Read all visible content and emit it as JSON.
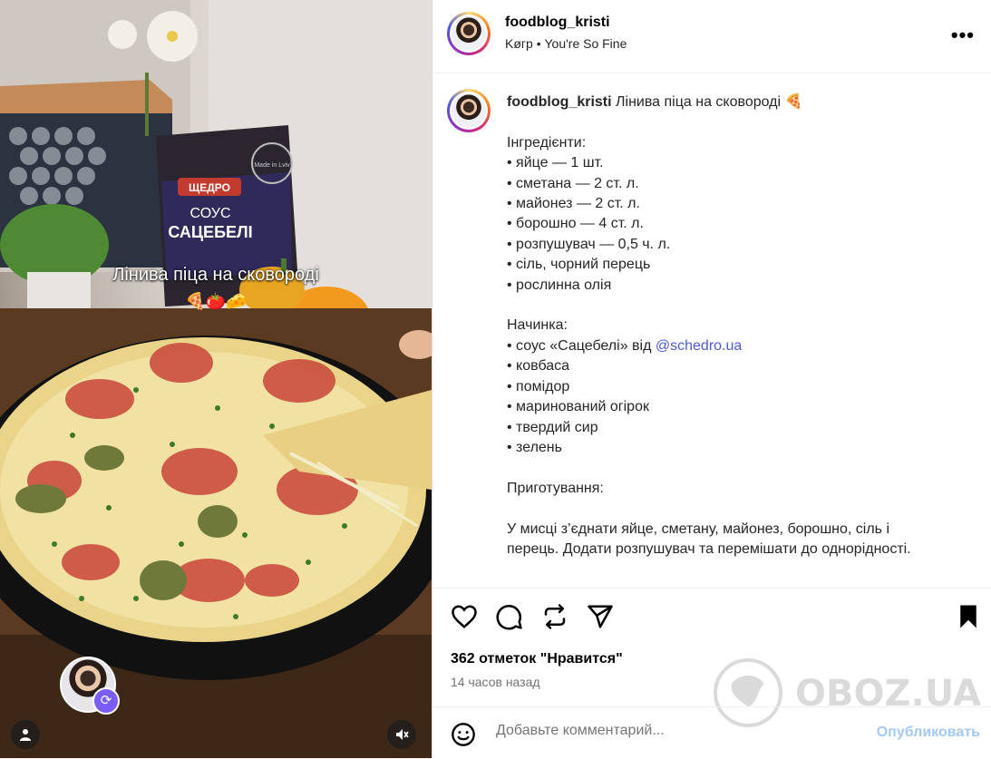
{
  "media": {
    "overlay_caption": "Лінива піца на сковороді",
    "overlay_emoji": "🍕🍅🧀",
    "package_brand": "ЩЕДРО",
    "package_type": "СОУС",
    "package_name": "САЦЕБЕЛІ",
    "package_stamp": "Made in Lviv"
  },
  "header": {
    "username": "foodblog_kristi",
    "audio_artist": "Køгр",
    "audio_separator": "•",
    "audio_track": "You're So Fine",
    "more_icon": "•••"
  },
  "caption": {
    "username": "foodblog_kristi",
    "title": "Лінива піца на сковороді 🍕",
    "ingredients_heading": "Інгредієнти:",
    "ingredients": [
      "• яйце — 1 шт.",
      "• сметана — 2 ст. л.",
      "• майонез — 2 ст. л.",
      "• борошно — 4 ст. л.",
      "• розпушувач — 0,5 ч. л.",
      "• сіль, чорний перець",
      "• рослинна олія"
    ],
    "filling_heading": "Начинка:",
    "filling_first_prefix": "• соус «Сацебелі» від ",
    "filling_first_mention": "@schedro.ua",
    "filling": [
      "• ковбаса",
      "• помідор",
      "• маринований огірок",
      "• твердий сир",
      "• зелень"
    ],
    "prep_heading": "Приготування:",
    "prep_line1": "У мисці з’єднати яйце, сметану, майонез, борошно, сіль і",
    "prep_line2": "перець. Додати розпушувач та перемішати до однорідності."
  },
  "actions": {
    "likes": "362 отметок \"Нравится\"",
    "timestamp": "14 часов назад"
  },
  "watermark": {
    "text": "OBOZ.UA"
  },
  "comment": {
    "placeholder": "Добавьте комментарий...",
    "post_label": "Опубликовать"
  }
}
